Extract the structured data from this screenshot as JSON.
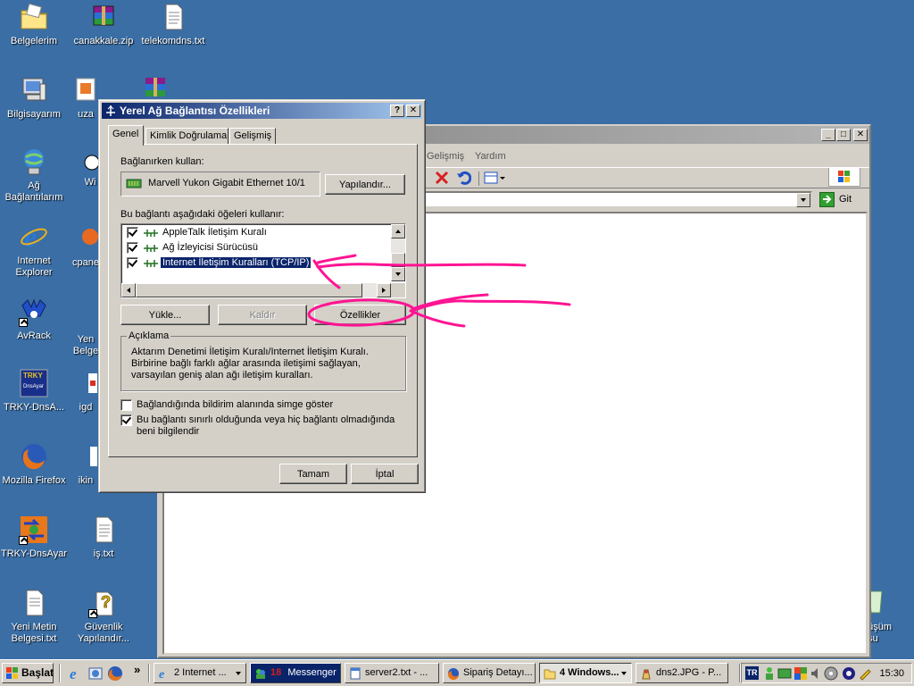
{
  "colors": {
    "desktop": "#3a6ea5",
    "title_active": "#0a246a",
    "title_inactive": "#808080",
    "face": "#d4d0c8",
    "annotation": "#ff1493"
  },
  "desktop_icons": [
    {
      "label": "Belgelerim",
      "icon": "folder-icon"
    },
    {
      "label": "canakkale.zip",
      "icon": "archive-icon"
    },
    {
      "label": "telekomdns.txt",
      "icon": "text-file-icon"
    },
    {
      "label": "Bilgisayarım",
      "icon": "computer-icon"
    },
    {
      "label": "uza",
      "icon": "package-icon"
    },
    {
      "label": "Ağ Bağlantılarım",
      "icon": "network-icon"
    },
    {
      "label": "Wi",
      "icon": "shortcut-icon"
    },
    {
      "label": "Internet Explorer",
      "icon": "ie-icon"
    },
    {
      "label": "cpane",
      "icon": "cpanel-icon"
    },
    {
      "label": "AvRack",
      "icon": "avrack-icon"
    },
    {
      "label": "Yen Belge",
      "icon": "text-file-icon"
    },
    {
      "label": "TRKY-DnsA...",
      "icon": "trky-icon"
    },
    {
      "label": "igd",
      "icon": "igd-icon"
    },
    {
      "label": "Mozilla Firefox",
      "icon": "firefox-icon"
    },
    {
      "label": "ikin",
      "icon": "file-icon"
    },
    {
      "label": "TRKY-DnsAyar",
      "icon": "dnsayar-icon"
    },
    {
      "label": "iş.txt",
      "icon": "text-file-icon"
    },
    {
      "label": "Yeni Metin Belgesi.txt",
      "icon": "text-file-icon"
    },
    {
      "label": "Güvenlik Yapılandır...",
      "icon": "security-config-icon"
    },
    {
      "label": "nüşüm usu",
      "icon": "recycle-icon"
    }
  ],
  "bg_window": {
    "menu_partial": [
      "Gelişmiş",
      "Yardım"
    ],
    "go_label": "Git"
  },
  "dialog": {
    "title": "Yerel Ağ Bağlantısı Özellikleri",
    "help_btn": "?",
    "close_btn": "✕",
    "tabs": [
      "Genel",
      "Kimlik Doğrulama",
      "Gelişmiş"
    ],
    "connect_using_label": "Bağlanırken kullan:",
    "adapter_name": "Marvell Yukon Gigabit Ethernet 10/1",
    "configure_btn": "Yapılandır...",
    "items_label": "Bu bağlantı aşağıdaki öğeleri kullanır:",
    "items": [
      {
        "label": "AppleTalk İletişim Kuralı",
        "checked": true,
        "selected": false
      },
      {
        "label": "Ağ İzleyicisi Sürücüsü",
        "checked": true,
        "selected": false
      },
      {
        "label": "Internet İletişim Kuralları (TCP/IP)",
        "checked": true,
        "selected": true
      }
    ],
    "install_btn": "Yükle...",
    "uninstall_btn": "Kaldır",
    "properties_btn": "Özellikler",
    "description_title": "Açıklama",
    "description_text": "Aktarım Denetimi İletişim Kuralı/Internet İletişim Kuralı. Birbirine bağlı farklı ağlar arasında iletişimi sağlayan, varsayılan geniş alan ağı iletişim kuralları.",
    "show_icon_label": "Bağlandığında bildirim alanında simge göster",
    "show_icon_checked": false,
    "notify_label": "Bu bağlantı sınırlı olduğunda veya hiç bağlantı olmadığında beni bilgilendir",
    "notify_checked": true,
    "ok_btn": "Tamam",
    "cancel_btn": "İptal"
  },
  "taskbar": {
    "start_label": "Başlat",
    "tasks": [
      {
        "label": "2 Internet ...",
        "icon": "ie-icon",
        "active": false
      },
      {
        "label": "Messenger",
        "icon": "messenger-icon",
        "active": false,
        "dark": true,
        "badge": "18"
      },
      {
        "label": "server2.txt - ...",
        "icon": "notepad-icon",
        "active": false
      },
      {
        "label": "Sipariş Detayı...",
        "icon": "firefox-icon",
        "active": false
      },
      {
        "label": "4 Windows...",
        "icon": "folder-icon",
        "active": true
      },
      {
        "label": "dns2.JPG - P...",
        "icon": "paint-icon",
        "active": false
      }
    ],
    "tray_lang": "TR",
    "clock": "15:30"
  }
}
